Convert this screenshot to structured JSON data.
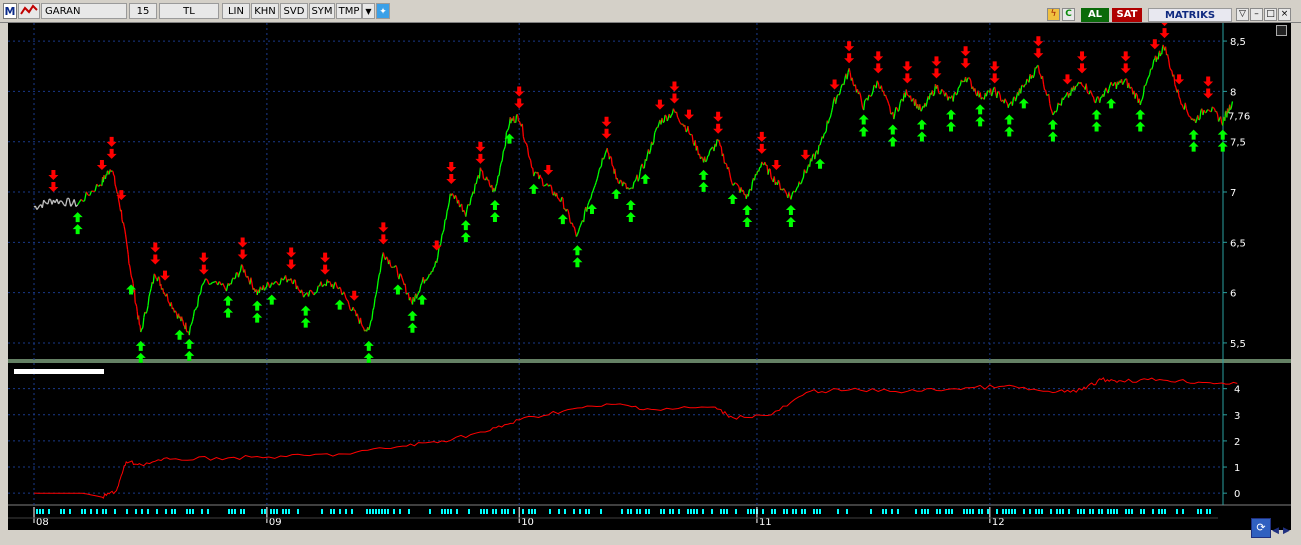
{
  "toolbar": {
    "symbol": "GARAN",
    "period": "15",
    "currency": "TL",
    "buttons": [
      "LIN",
      "KHN",
      "SVD",
      "SYM",
      "TMP"
    ],
    "buy_label": "AL",
    "sell_label": "SAT",
    "brand": "MATRIKS"
  },
  "colors": {
    "background": "#000000",
    "price_up": "#00ff00",
    "price_down": "#ff0000",
    "buy_arrow": "#00ff00",
    "sell_arrow": "#ff0000",
    "equity_line": "#ff0000",
    "grid": "#1a3a8a",
    "axis_text": "#ffffff",
    "separator": "#c8ffc8",
    "volume_marks": "#00ffff"
  },
  "chart_data": [
    {
      "type": "line",
      "name": "price",
      "y_ticks": [
        5.5,
        6,
        6.5,
        7,
        7.5,
        8,
        8.5
      ],
      "y_tick_labels": [
        "5,5",
        "6",
        "6,5",
        "7",
        "7,5",
        "8",
        "8,5"
      ],
      "last_value_label": "7,76",
      "ylim": [
        5.4,
        8.6
      ],
      "x_ticks": [
        0.0,
        0.24,
        0.5,
        0.745,
        0.985
      ],
      "x_tick_labels": [
        "08",
        "09",
        "10",
        "11",
        "12"
      ],
      "points": [
        [
          0.0,
          6.85
        ],
        [
          0.02,
          6.92
        ],
        [
          0.045,
          6.88
        ],
        [
          0.07,
          7.1
        ],
        [
          0.08,
          7.25
        ],
        [
          0.09,
          6.8
        ],
        [
          0.1,
          6.2
        ],
        [
          0.11,
          5.6
        ],
        [
          0.125,
          6.2
        ],
        [
          0.135,
          6.0
        ],
        [
          0.15,
          5.75
        ],
        [
          0.16,
          5.62
        ],
        [
          0.175,
          6.1
        ],
        [
          0.2,
          6.05
        ],
        [
          0.215,
          6.25
        ],
        [
          0.23,
          6.0
        ],
        [
          0.245,
          6.1
        ],
        [
          0.265,
          6.15
        ],
        [
          0.28,
          5.95
        ],
        [
          0.3,
          6.1
        ],
        [
          0.315,
          6.05
        ],
        [
          0.33,
          5.8
        ],
        [
          0.345,
          5.6
        ],
        [
          0.36,
          6.4
        ],
        [
          0.375,
          6.2
        ],
        [
          0.39,
          5.9
        ],
        [
          0.4,
          6.1
        ],
        [
          0.415,
          6.3
        ],
        [
          0.43,
          7.0
        ],
        [
          0.445,
          6.8
        ],
        [
          0.46,
          7.2
        ],
        [
          0.475,
          7.0
        ],
        [
          0.49,
          7.7
        ],
        [
          0.5,
          7.75
        ],
        [
          0.515,
          7.2
        ],
        [
          0.53,
          7.05
        ],
        [
          0.545,
          6.9
        ],
        [
          0.56,
          6.55
        ],
        [
          0.575,
          7.0
        ],
        [
          0.59,
          7.45
        ],
        [
          0.6,
          7.15
        ],
        [
          0.615,
          7.0
        ],
        [
          0.63,
          7.3
        ],
        [
          0.645,
          7.7
        ],
        [
          0.66,
          7.8
        ],
        [
          0.675,
          7.6
        ],
        [
          0.69,
          7.3
        ],
        [
          0.705,
          7.5
        ],
        [
          0.72,
          7.1
        ],
        [
          0.735,
          6.95
        ],
        [
          0.75,
          7.3
        ],
        [
          0.765,
          7.1
        ],
        [
          0.78,
          6.95
        ],
        [
          0.795,
          7.2
        ],
        [
          0.81,
          7.45
        ],
        [
          0.825,
          7.9
        ],
        [
          0.84,
          8.2
        ],
        [
          0.855,
          7.85
        ],
        [
          0.87,
          8.1
        ],
        [
          0.885,
          7.75
        ],
        [
          0.9,
          8.0
        ],
        [
          0.915,
          7.8
        ],
        [
          0.93,
          8.05
        ],
        [
          0.945,
          7.9
        ],
        [
          0.96,
          8.15
        ],
        [
          0.975,
          7.95
        ],
        [
          0.99,
          8.0
        ],
        [
          1.005,
          7.85
        ],
        [
          1.02,
          8.05
        ],
        [
          1.035,
          8.25
        ],
        [
          1.05,
          7.8
        ],
        [
          1.065,
          7.95
        ],
        [
          1.08,
          8.1
        ],
        [
          1.095,
          7.9
        ],
        [
          1.11,
          8.05
        ],
        [
          1.125,
          8.1
        ],
        [
          1.14,
          7.9
        ],
        [
          1.155,
          8.3
        ],
        [
          1.165,
          8.45
        ],
        [
          1.18,
          7.95
        ],
        [
          1.195,
          7.7
        ],
        [
          1.21,
          7.85
        ],
        [
          1.225,
          7.7
        ],
        [
          1.235,
          7.9
        ]
      ]
    },
    {
      "type": "line",
      "name": "equity",
      "y_ticks": [
        0,
        1,
        2,
        3,
        4
      ],
      "y_tick_labels": [
        "0",
        "1",
        "2",
        "3",
        "4"
      ],
      "ylim": [
        -0.3,
        4.6
      ],
      "x": [
        0.0,
        0.05,
        0.07,
        0.085,
        0.095,
        0.11,
        0.14,
        0.2,
        0.26,
        0.32,
        0.38,
        0.42,
        0.47,
        0.5,
        0.55,
        0.6,
        0.64,
        0.7,
        0.72,
        0.76,
        0.8,
        0.84,
        0.9,
        0.95,
        1.0,
        1.05,
        1.08,
        1.1,
        1.12,
        1.16,
        1.2,
        1.24
      ],
      "values": [
        0.0,
        0.0,
        -0.15,
        0.1,
        1.2,
        1.1,
        1.3,
        1.35,
        1.4,
        1.5,
        1.8,
        2.0,
        2.4,
        2.8,
        3.2,
        3.4,
        3.2,
        3.3,
        2.9,
        3.0,
        3.9,
        3.95,
        3.9,
        4.0,
        4.1,
        3.85,
        3.95,
        4.35,
        4.3,
        4.35,
        4.25,
        4.2
      ]
    }
  ]
}
